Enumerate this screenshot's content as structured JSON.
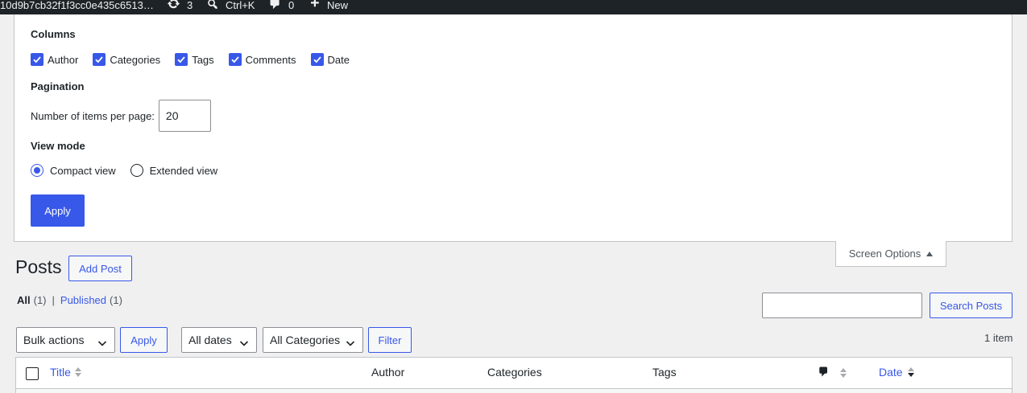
{
  "admin_bar": {
    "site_label": "10d9b7cb32f1f3cc0e435c6513…",
    "updates_count": "3",
    "search_shortcut": "Ctrl+K",
    "comments_count": "0",
    "new_label": "New"
  },
  "screen_options": {
    "columns_heading": "Columns",
    "columns": [
      {
        "label": "Author",
        "checked": true
      },
      {
        "label": "Categories",
        "checked": true
      },
      {
        "label": "Tags",
        "checked": true
      },
      {
        "label": "Comments",
        "checked": true
      },
      {
        "label": "Date",
        "checked": true
      }
    ],
    "pagination_heading": "Pagination",
    "per_page_label": "Number of items per page:",
    "per_page_value": "20",
    "view_mode_heading": "View mode",
    "view_modes": [
      {
        "label": "Compact view",
        "checked": true
      },
      {
        "label": "Extended view",
        "checked": false
      }
    ],
    "apply_label": "Apply",
    "tab_label": "Screen Options"
  },
  "page": {
    "title": "Posts",
    "add_post_label": "Add Post"
  },
  "filters": {
    "all_label": "All",
    "all_count": "(1)",
    "separator": "|",
    "published_label": "Published",
    "published_count": "(1)"
  },
  "search": {
    "value": "",
    "button_label": "Search Posts"
  },
  "tablenav": {
    "bulk_actions": "Bulk actions",
    "apply_label": "Apply",
    "dates": "All dates",
    "categories": "All Categories",
    "filter_label": "Filter",
    "items_count": "1 item"
  },
  "table": {
    "columns": {
      "title": "Title",
      "author": "Author",
      "categories": "Categories",
      "tags": "Tags",
      "date": "Date"
    }
  },
  "colors": {
    "accent": "#3858e9",
    "admin_bar": "#1d2327",
    "background": "#f0f0f1"
  }
}
